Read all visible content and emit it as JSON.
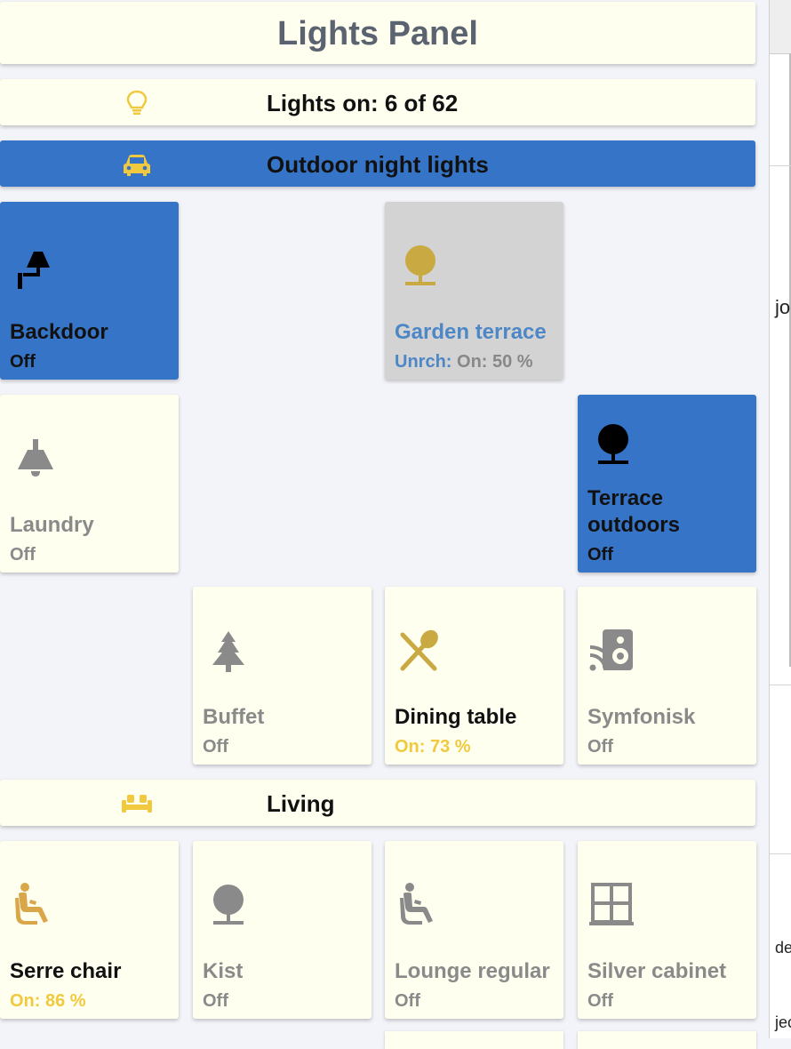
{
  "title": "Lights Panel",
  "status": {
    "label": "Lights on: 6 of 62",
    "icon": "lightbulb-icon"
  },
  "colors": {
    "accent_blue": "#3574c6",
    "tile_bg": "#fffff0",
    "on_yellow": "#f0c93f",
    "off_gray": "#8a8a8a",
    "unreachable_gray": "#d3d3d3"
  },
  "sections": {
    "outdoor": {
      "label": "Outdoor night lights",
      "icon": "car-icon"
    },
    "living": {
      "label": "Living",
      "icon": "sofa-icon"
    }
  },
  "tiles": {
    "backdoor": {
      "name": "Backdoor",
      "state": "Off",
      "icon": "wall-lamp-icon"
    },
    "garden_terrace": {
      "name": "Garden terrace",
      "state_prefix": "Unrch:",
      "state": " On: 50 %",
      "icon": "garden-light-icon"
    },
    "laundry": {
      "name": "Laundry",
      "state": "Off",
      "icon": "ceiling-lamp-icon"
    },
    "terrace_outdoors": {
      "name_line1": "Terrace",
      "name_line2": "outdoors",
      "state": "Off",
      "icon": "garden-light-icon"
    },
    "buffet": {
      "name": "Buffet",
      "state": "Off",
      "icon": "pine-tree-icon"
    },
    "dining_table": {
      "name": "Dining table",
      "state": "On: 73 %",
      "icon": "utensils-icon"
    },
    "symfonisk": {
      "name": "Symfonisk",
      "state": "Off",
      "icon": "speaker-wifi-icon"
    },
    "serre_chair": {
      "name": "Serre chair",
      "state": "On: 86 %",
      "icon": "seated-person-icon"
    },
    "kist": {
      "name": "Kist",
      "state": "Off",
      "icon": "garden-light-icon"
    },
    "lounge_regular": {
      "name": "Lounge regular",
      "state": "Off",
      "icon": "seated-person-icon"
    },
    "silver_cabinet": {
      "name": "Silver cabinet",
      "state": "Off",
      "icon": "window-grid-icon"
    }
  },
  "background_fragments": {
    "a": "jo",
    "b": "de",
    "c": "jec"
  }
}
